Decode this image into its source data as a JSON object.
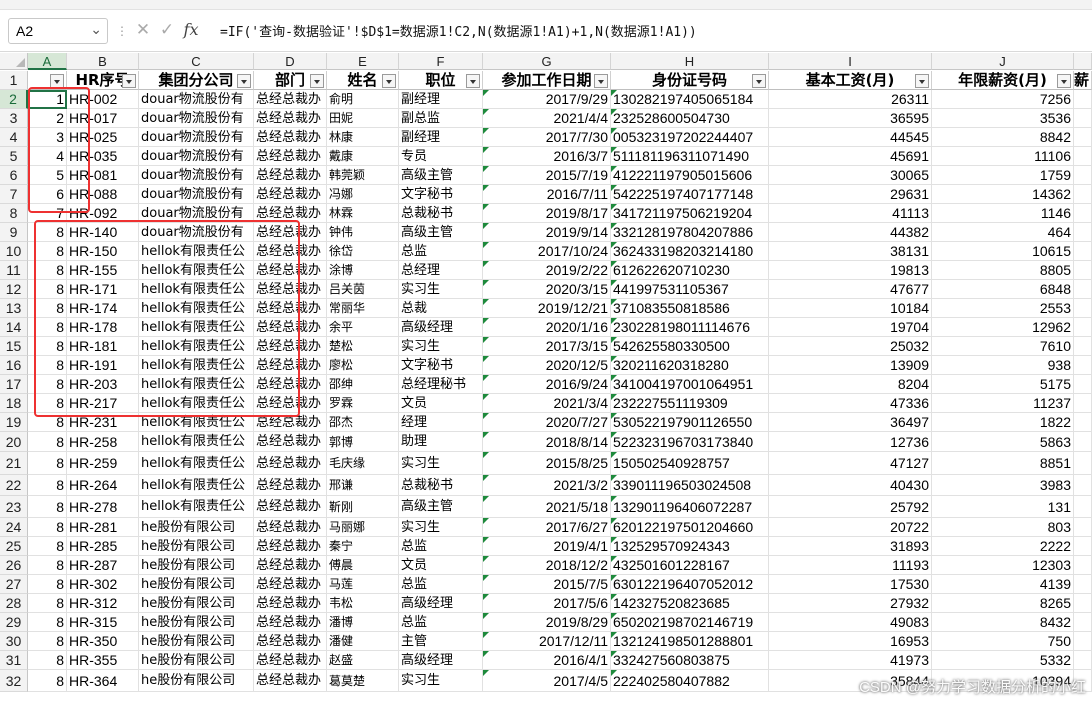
{
  "formula_bar": {
    "name_box": "A2",
    "formula": "=IF('查询-数据验证'!$D$1=数据源1!C2,N(数据源1!A1)+1,N(数据源1!A1))"
  },
  "columns": [
    "A",
    "B",
    "C",
    "D",
    "E",
    "F",
    "G",
    "H",
    "I",
    "J"
  ],
  "header_row": {
    "row_number": "1",
    "labels": [
      "",
      "HR序号",
      "集团分公司",
      "部门",
      "姓名",
      "职位",
      "参加工作日期",
      "身份证号码",
      "基本工资(月)",
      "年限薪资(月)"
    ],
    "partial_next": "薪"
  },
  "rows": [
    {
      "n": "2",
      "a": "1",
      "b": "HR-002",
      "c": "douar物流股份有",
      "d": "总经总裁办",
      "e": "俞明",
      "f": "副经理",
      "g": "2017/9/29",
      "h": "130282197405065184",
      "i": "26311",
      "j": "7256"
    },
    {
      "n": "3",
      "a": "2",
      "b": "HR-017",
      "c": "douar物流股份有",
      "d": "总经总裁办",
      "e": "田妮",
      "f": "副总监",
      "g": "2021/4/4",
      "h": "232528600504730",
      "i": "36595",
      "j": "3536"
    },
    {
      "n": "4",
      "a": "3",
      "b": "HR-025",
      "c": "douar物流股份有",
      "d": "总经总裁办",
      "e": "林康",
      "f": "副经理",
      "g": "2017/7/30",
      "h": "005323197202244407",
      "i": "44545",
      "j": "8842"
    },
    {
      "n": "5",
      "a": "4",
      "b": "HR-035",
      "c": "douar物流股份有",
      "d": "总经总裁办",
      "e": "戴康",
      "f": "专员",
      "g": "2016/3/7",
      "h": "511181196311071490",
      "i": "45691",
      "j": "11106"
    },
    {
      "n": "6",
      "a": "5",
      "b": "HR-081",
      "c": "douar物流股份有",
      "d": "总经总裁办",
      "e": "韩莞颖",
      "f": "高级主管",
      "g": "2015/7/19",
      "h": "412221197905015606",
      "i": "30065",
      "j": "1759"
    },
    {
      "n": "7",
      "a": "6",
      "b": "HR-088",
      "c": "douar物流股份有",
      "d": "总经总裁办",
      "e": "冯娜",
      "f": "文字秘书",
      "g": "2016/7/11",
      "h": "542225197407177148",
      "i": "29631",
      "j": "14362"
    },
    {
      "n": "8",
      "a": "7",
      "b": "HR-092",
      "c": "douar物流股份有",
      "d": "总经总裁办",
      "e": "林霖",
      "f": "总裁秘书",
      "g": "2019/8/17",
      "h": "341721197506219204",
      "i": "41113",
      "j": "1146"
    },
    {
      "n": "9",
      "a": "8",
      "b": "HR-140",
      "c": "douar物流股份有",
      "d": "总经总裁办",
      "e": "钟伟",
      "f": "高级主管",
      "g": "2019/9/14",
      "h": "332128197804207886",
      "i": "44382",
      "j": "464"
    },
    {
      "n": "10",
      "a": "8",
      "b": "HR-150",
      "c": "hellok有限责任公",
      "d": "总经总裁办",
      "e": "徐岱",
      "f": "总监",
      "g": "2017/10/24",
      "h": "362433198203214180",
      "i": "38131",
      "j": "10615"
    },
    {
      "n": "11",
      "a": "8",
      "b": "HR-155",
      "c": "hellok有限责任公",
      "d": "总经总裁办",
      "e": "涂博",
      "f": "总经理",
      "g": "2019/2/22",
      "h": "612622620710230",
      "i": "19813",
      "j": "8805"
    },
    {
      "n": "12",
      "a": "8",
      "b": "HR-171",
      "c": "hellok有限责任公",
      "d": "总经总裁办",
      "e": "吕关茵",
      "f": "实习生",
      "g": "2020/3/15",
      "h": "441997531105367",
      "i": "47677",
      "j": "6848"
    },
    {
      "n": "13",
      "a": "8",
      "b": "HR-174",
      "c": "hellok有限责任公",
      "d": "总经总裁办",
      "e": "常丽华",
      "f": "总裁",
      "g": "2019/12/21",
      "h": "371083550818586",
      "i": "10184",
      "j": "2553"
    },
    {
      "n": "14",
      "a": "8",
      "b": "HR-178",
      "c": "hellok有限责任公",
      "d": "总经总裁办",
      "e": "余平",
      "f": "高级经理",
      "g": "2020/1/16",
      "h": "230228198011114676",
      "i": "19704",
      "j": "12962"
    },
    {
      "n": "15",
      "a": "8",
      "b": "HR-181",
      "c": "hellok有限责任公",
      "d": "总经总裁办",
      "e": "楚松",
      "f": "实习生",
      "g": "2017/3/15",
      "h": "542625580330500",
      "i": "25032",
      "j": "7610"
    },
    {
      "n": "16",
      "a": "8",
      "b": "HR-191",
      "c": "hellok有限责任公",
      "d": "总经总裁办",
      "e": "廖松",
      "f": "文字秘书",
      "g": "2020/12/5",
      "h": "320211620318280",
      "i": "13909",
      "j": "938"
    },
    {
      "n": "17",
      "a": "8",
      "b": "HR-203",
      "c": "hellok有限责任公",
      "d": "总经总裁办",
      "e": "邵绅",
      "f": "总经理秘书",
      "g": "2016/9/24",
      "h": "341004197001064951",
      "i": "8204",
      "j": "5175"
    },
    {
      "n": "18",
      "a": "8",
      "b": "HR-217",
      "c": "hellok有限责任公",
      "d": "总经总裁办",
      "e": "罗霖",
      "f": "文员",
      "g": "2021/3/4",
      "h": "232227551119309",
      "i": "47336",
      "j": "11237"
    },
    {
      "n": "19",
      "a": "8",
      "b": "HR-231",
      "c": "hellok有限责任公",
      "d": "总经总裁办",
      "e": "邵杰",
      "f": "经理",
      "g": "2020/7/27",
      "h": "530522197901126550",
      "i": "36497",
      "j": "1822"
    },
    {
      "n": "20",
      "a": "8",
      "b": "HR-258",
      "c": "hellok有限责任公",
      "d": "总经总裁办",
      "e": "郭博",
      "f": "助理",
      "g": "2018/8/14",
      "h": "522323196703173840",
      "i": "12736",
      "j": "5863"
    },
    {
      "n": "21",
      "a": "8",
      "b": "HR-259",
      "c": "hellok有限责任公",
      "d": "总经总裁办",
      "e": "毛庆缘",
      "f": "实习生",
      "g": "2015/8/25",
      "h": "150502540928757",
      "i": "47127",
      "j": "8851"
    },
    {
      "n": "22",
      "a": "8",
      "b": "HR-264",
      "c": "hellok有限责任公",
      "d": "总经总裁办",
      "e": "邢谦",
      "f": "总裁秘书",
      "g": "2021/3/2",
      "h": "339011196503024508",
      "i": "40430",
      "j": "3983"
    },
    {
      "n": "23",
      "a": "8",
      "b": "HR-278",
      "c": "hellok有限责任公",
      "d": "总经总裁办",
      "e": "靳刚",
      "f": "高级主管",
      "g": "2021/5/18",
      "h": "132901196406072287",
      "i": "25792",
      "j": "131"
    },
    {
      "n": "24",
      "a": "8",
      "b": "HR-281",
      "c": "he股份有限公司",
      "d": "总经总裁办",
      "e": "马丽娜",
      "f": "实习生",
      "g": "2017/6/27",
      "h": "620122197501204660",
      "i": "20722",
      "j": "803"
    },
    {
      "n": "25",
      "a": "8",
      "b": "HR-285",
      "c": "he股份有限公司",
      "d": "总经总裁办",
      "e": "秦宁",
      "f": "总监",
      "g": "2019/4/1",
      "h": "132529570924343",
      "i": "31893",
      "j": "2222"
    },
    {
      "n": "26",
      "a": "8",
      "b": "HR-287",
      "c": "he股份有限公司",
      "d": "总经总裁办",
      "e": "傅晨",
      "f": "文员",
      "g": "2018/12/2",
      "h": "432501601228167",
      "i": "11193",
      "j": "12303"
    },
    {
      "n": "27",
      "a": "8",
      "b": "HR-302",
      "c": "he股份有限公司",
      "d": "总经总裁办",
      "e": "马莲",
      "f": "总监",
      "g": "2015/7/5",
      "h": "630122196407052012",
      "i": "17530",
      "j": "4139"
    },
    {
      "n": "28",
      "a": "8",
      "b": "HR-312",
      "c": "he股份有限公司",
      "d": "总经总裁办",
      "e": "韦松",
      "f": "高级经理",
      "g": "2017/5/6",
      "h": "142327520823685",
      "i": "27932",
      "j": "8265"
    },
    {
      "n": "29",
      "a": "8",
      "b": "HR-315",
      "c": "he股份有限公司",
      "d": "总经总裁办",
      "e": "潘博",
      "f": "总监",
      "g": "2019/8/29",
      "h": "650202198702146719",
      "i": "49083",
      "j": "8432"
    },
    {
      "n": "30",
      "a": "8",
      "b": "HR-350",
      "c": "he股份有限公司",
      "d": "总经总裁办",
      "e": "潘健",
      "f": "主管",
      "g": "2017/12/11",
      "h": "132124198501288801",
      "i": "16953",
      "j": "750"
    },
    {
      "n": "31",
      "a": "8",
      "b": "HR-355",
      "c": "he股份有限公司",
      "d": "总经总裁办",
      "e": "赵盛",
      "f": "高级经理",
      "g": "2016/4/1",
      "h": "332427560803875",
      "i": "41973",
      "j": "5332"
    },
    {
      "n": "32",
      "a": "8",
      "b": "HR-364",
      "c": "he股份有限公司",
      "d": "总经总裁办",
      "e": "葛莫楚",
      "f": "实习生",
      "g": "2017/4/5",
      "h": "222402580407882",
      "i": "35844",
      "j": "10394"
    }
  ],
  "watermark": "CSDN @努力学习数据分析的小红",
  "colors": {
    "accent": "#217346",
    "highlight_box": "#ee3131"
  },
  "icons": {
    "cancel": "cross-icon",
    "confirm": "check-icon",
    "function": "fx-icon",
    "dropdown": "chevron-down-icon"
  }
}
